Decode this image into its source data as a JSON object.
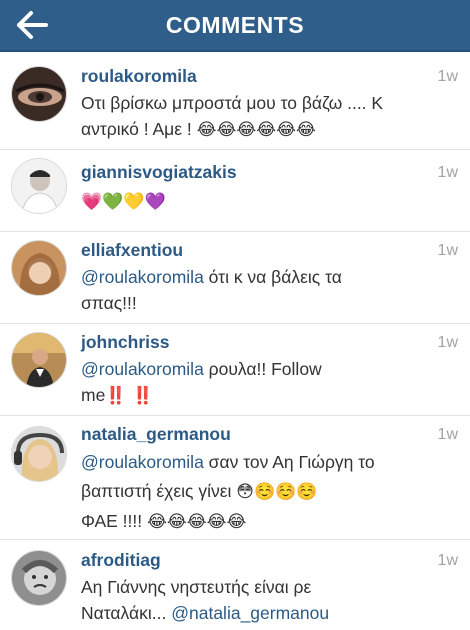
{
  "header": {
    "title": "COMMENTS"
  },
  "comments": [
    {
      "username": "roulakoromila",
      "time": "1w",
      "line1": "Οτι βρίσκω μπροστά μου το βάζω .... Κ",
      "line2": "αντρικό ! Αμε !",
      "emojis": "😂😂😂😂😂😂"
    },
    {
      "username": "giannisvogiatzakis",
      "time": "1w",
      "emojis": "💗💚💛💜"
    },
    {
      "username": "elliafxentiou",
      "time": "1w",
      "mention": "@roulakoromila",
      "line1": " ότι κ να βάλεις τα",
      "line2": "σπας!!!"
    },
    {
      "username": "johnchriss",
      "time": "1w",
      "mention": "@roulakoromila",
      "line1": " ρουλα!! Follow",
      "line2": "me",
      "bangs": "‼️ ‼️"
    },
    {
      "username": "natalia_germanou",
      "time": "1w",
      "mention": "@roulakoromila",
      "line1": " σαν τον Αη Γιώργη το",
      "line2": "βαπτιστή έχεις γίνει ",
      "line2_emojis": "😳☺️☺️☺️",
      "line3": "ΦΑΕ !!!! ",
      "line3_emojis": "😂😂😂😂😂"
    },
    {
      "username": "afroditiag",
      "time": "1w",
      "line1": "Αη Γιάννης νηστευτής είναι ρε",
      "line2": "Ναταλάκι... ",
      "mention": "@natalia_germanou"
    }
  ]
}
